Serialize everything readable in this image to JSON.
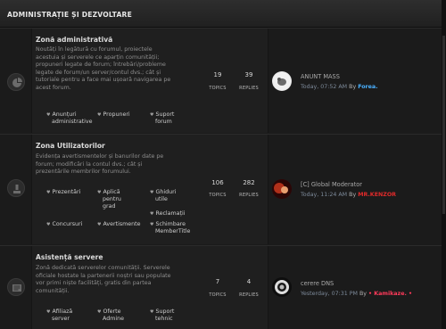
{
  "header": {
    "title": "ADMINISTRAȚIE ȘI DEZVOLTARE"
  },
  "forums": [
    {
      "title": "Zonă administrativă",
      "desc_lines": [
        "Noutăți în legătură cu forumul, proiectele",
        "acestuia și serverele ce aparțin comunității;",
        "propuneri legate de forum; întrebări/probleme",
        "legate de forum/un server/contul dvs.; cât și",
        "tutoriale pentru a face mai ușoară navigarea pe",
        "acest forum."
      ],
      "subforums": [
        {
          "lines": [
            "Anunțuri",
            "administrative"
          ]
        },
        {
          "lines": [
            "Propuneri"
          ]
        },
        {
          "lines": [
            "Suport",
            "forum"
          ]
        }
      ],
      "topics": "19",
      "replies": "39",
      "topics_label": "TOPICS",
      "replies_label": "REPLIES",
      "last_post_title": "ANUNT MASS",
      "last_post_time": "Today, 07:52 AM",
      "last_post_by": "By",
      "last_post_user": "Forea.",
      "icon": "pie-chart-icon"
    },
    {
      "title": "Zona Utilizatorilor",
      "desc_lines": [
        "Evidența avertismentelor și banurilor date pe",
        "forum; modificări la contul dvs.; cât și",
        "prezentările membrilor forumului."
      ],
      "subforums": [
        {
          "lines": [
            "Prezentări"
          ]
        },
        {
          "lines": [
            "Aplică",
            "pentru",
            "grad"
          ]
        },
        {
          "lines": [
            "Ghiduri",
            "utile"
          ]
        },
        {
          "lines": [
            "Reclamații"
          ]
        },
        {
          "lines": [
            "Concursuri"
          ]
        },
        {
          "lines": [
            "Avertismente"
          ]
        },
        {
          "lines": [
            "Schimbare",
            "MemberTitle"
          ]
        }
      ],
      "topics": "106",
      "replies": "282",
      "topics_label": "TOPICS",
      "replies_label": "REPLIES",
      "last_post_title": "[C] Global Moderator",
      "last_post_time": "Today, 11:24 AM",
      "last_post_by": "By",
      "last_post_user": "MR.KENZOR",
      "icon": "user-icon"
    },
    {
      "title": "Asistență servere",
      "desc_lines": [
        "Zonă dedicată serverelor comunității. Serverele",
        "oficiale hostate la partenerii noștri sau populate",
        "vor primi niște facilități, gratis din partea",
        "comunității."
      ],
      "subforums": [
        {
          "lines": [
            "Afiliază",
            "server"
          ]
        },
        {
          "lines": [
            "Oferte",
            "Admine"
          ]
        },
        {
          "lines": [
            "Suport",
            "tehnic"
          ]
        }
      ],
      "topics": "7",
      "replies": "4",
      "topics_label": "TOPICS",
      "replies_label": "REPLIES",
      "last_post_title": "cerere DNS",
      "last_post_time": "Yesterday, 07:31 PM",
      "last_post_by": "By",
      "last_post_user": "• Kamikaze. •",
      "icon": "document-list-icon"
    }
  ],
  "colors": {
    "user_blue": "#4ab0ff",
    "user_red": "#e02a2a",
    "user_pink": "#ff3a5a"
  }
}
